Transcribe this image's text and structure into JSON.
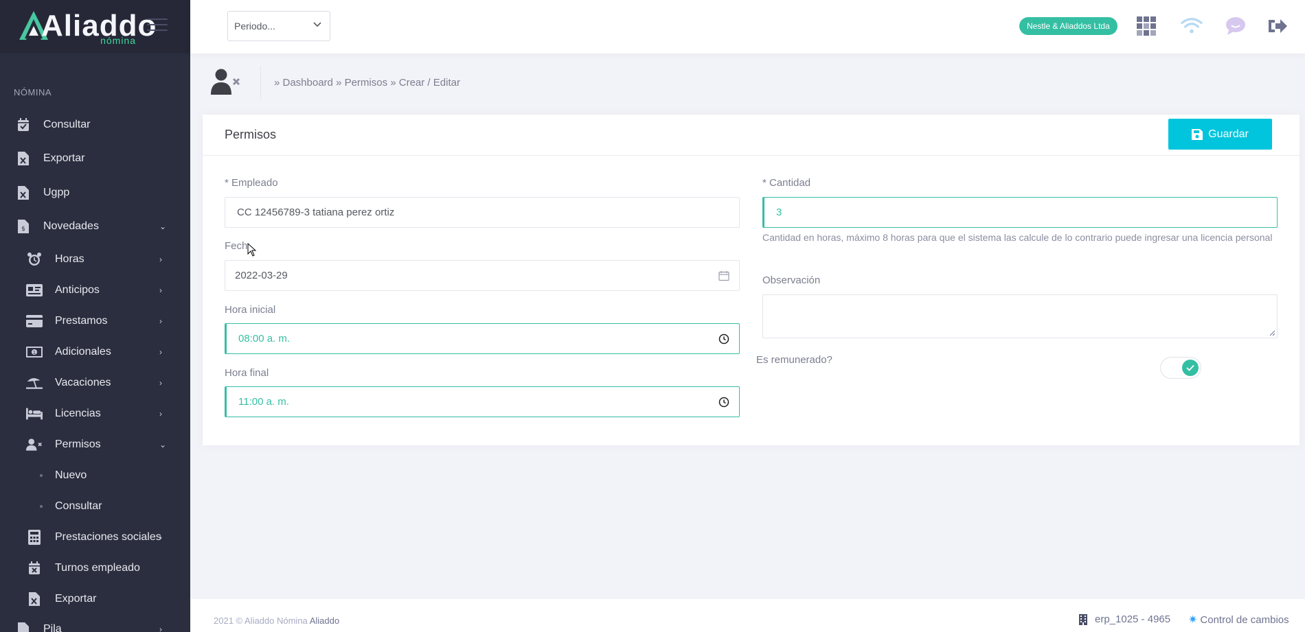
{
  "brand": {
    "logo_text": "Aliaddo",
    "logo_sub": "nómina"
  },
  "sidebar": {
    "section": "NÓMINA",
    "items": [
      {
        "label": "Consultar",
        "icon": "calendar-check-icon"
      },
      {
        "label": "Exportar",
        "icon": "excel-file-icon"
      },
      {
        "label": "Ugpp",
        "icon": "excel-file-icon"
      },
      {
        "label": "Novedades",
        "icon": "money-file-icon"
      },
      {
        "label": "Horas",
        "icon": "alarm-clock-icon"
      },
      {
        "label": "Anticipos",
        "icon": "id-card-icon"
      },
      {
        "label": "Prestamos",
        "icon": "credit-card-icon"
      },
      {
        "label": "Adicionales",
        "icon": "money-bill-icon"
      },
      {
        "label": "Vacaciones",
        "icon": "umbrella-beach-icon"
      },
      {
        "label": "Licencias",
        "icon": "bed-icon"
      },
      {
        "label": "Permisos",
        "icon": "user-times-icon"
      },
      {
        "label": "Nuevo"
      },
      {
        "label": "Consultar"
      },
      {
        "label": "Prestaciones sociales",
        "icon": "calculator-icon"
      },
      {
        "label": "Turnos empleado",
        "icon": "calendar-times-icon"
      },
      {
        "label": "Exportar",
        "icon": "excel-file-icon"
      },
      {
        "label": "Pila",
        "icon": "file-icon"
      }
    ]
  },
  "header": {
    "period_placeholder": "Periodo...",
    "company": "Nestle & Aliaddos Ltda"
  },
  "breadcrumb": "» Dashboard » Permisos » Crear / Editar",
  "form": {
    "title": "Permisos",
    "save_label": "Guardar",
    "empleado_label": "* Empleado",
    "empleado_value": "CC 12456789-3 tatiana perez ortiz",
    "fecha_label": "Fech",
    "fecha_value": "2022-03-29",
    "hora_inicial_label": "Hora inicial",
    "hora_inicial_value": "08:00 a. m.",
    "hora_final_label": "Hora final",
    "hora_final_value": "11:00 a. m.",
    "cantidad_label": "* Cantidad",
    "cantidad_value": "3",
    "cantidad_help": "Cantidad en horas, máximo 8 horas para que el sistema las calcule de lo contrario puede ingresar una licencia personal",
    "observacion_label": "Observación",
    "remunerado_label": "Es remunerado?",
    "remunerado_checked": true
  },
  "footer": {
    "copyright": "2021 © Aliaddo Nómina",
    "copyright_brand": "Aliaddo",
    "erp": "erp_1025 - 4965",
    "changes": "Control de cambios"
  },
  "colors": {
    "accent": "#34bfa3",
    "primary_button": "#00c5dc",
    "sidebar": "#2b2e3e"
  }
}
